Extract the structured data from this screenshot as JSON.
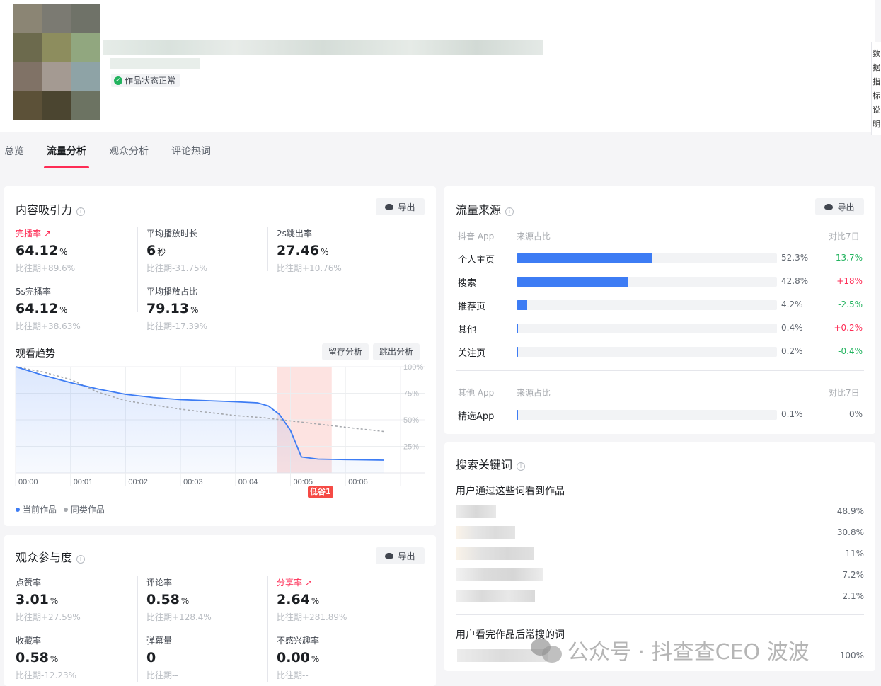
{
  "header": {
    "status_text": "作品状态正常",
    "side_text": [
      "数",
      "据",
      "指",
      "标",
      "说",
      "明"
    ]
  },
  "tabs": [
    {
      "label": "总览",
      "active": false
    },
    {
      "label": "流量分析",
      "active": true
    },
    {
      "label": "观众分析",
      "active": false
    },
    {
      "label": "评论热词",
      "active": false
    }
  ],
  "content_appeal": {
    "title": "内容吸引力",
    "export_label": "导出",
    "metrics": [
      {
        "label": "完播率",
        "value": "64.12",
        "unit": "%",
        "compare": "比往期+89.6%",
        "highlight": true
      },
      {
        "label": "平均播放时长",
        "value": "6",
        "unit": "秒",
        "compare": "比往期-31.75%",
        "highlight": false
      },
      {
        "label": "2s跳出率",
        "value": "27.46",
        "unit": "%",
        "compare": "比往期+10.76%",
        "highlight": false
      },
      {
        "label": "5s完播率",
        "value": "64.12",
        "unit": "%",
        "compare": "比往期+38.63%",
        "highlight": false
      },
      {
        "label": "平均播放占比",
        "value": "79.13",
        "unit": "%",
        "compare": "比往期-17.39%",
        "highlight": false
      }
    ],
    "trend_title": "观看趋势",
    "retention_btn": "留存分析",
    "bounce_btn": "跳出分析",
    "low_valley_label": "低谷1",
    "legend": [
      {
        "name": "当前作品",
        "color": "#3d7cf4"
      },
      {
        "name": "同类作品",
        "color": "#a6a9ae"
      }
    ]
  },
  "chart_data": {
    "type": "line",
    "x": [
      "00:00",
      "00:01",
      "00:02",
      "00:03",
      "00:04",
      "00:05",
      "00:06"
    ],
    "ylim": [
      0,
      100
    ],
    "yticks": [
      "100%",
      "75%",
      "50%",
      "25%"
    ],
    "grid": true,
    "legend_position": "bottom-left",
    "series": [
      {
        "name": "当前作品",
        "color": "#3d7cf4",
        "x": [
          0,
          0.5,
          1,
          1.5,
          2,
          2.5,
          3,
          3.5,
          4,
          4.4,
          4.6,
          4.8,
          5.0,
          5.2,
          5.5,
          6.0,
          6.7
        ],
        "values": [
          100,
          92,
          85,
          79,
          74,
          71,
          69,
          68,
          67,
          66,
          63,
          55,
          40,
          15,
          13,
          12.5,
          12
        ]
      },
      {
        "name": "同类作品",
        "color": "#a6a9ae",
        "x": [
          0,
          0.5,
          1,
          1.5,
          2,
          2.5,
          3,
          3.5,
          4,
          4.5,
          5,
          5.5,
          6,
          6.7
        ],
        "values": [
          100,
          95,
          88,
          76,
          68,
          64,
          60,
          57,
          54,
          52,
          49,
          46,
          43,
          39
        ]
      }
    ],
    "highlight_band": {
      "x_start": 4.75,
      "x_end": 5.75,
      "label": "低谷1"
    }
  },
  "traffic_source": {
    "title": "流量来源",
    "export_label": "导出",
    "douyin_header": [
      "抖音 App",
      "来源占比",
      "对比7日"
    ],
    "douyin_rows": [
      {
        "name": "个人主页",
        "pct": "52.3%",
        "ratio": 52.3,
        "change": "-13.7%",
        "dir": "down"
      },
      {
        "name": "搜索",
        "pct": "42.8%",
        "ratio": 42.8,
        "change": "+18%",
        "dir": "up"
      },
      {
        "name": "推荐页",
        "pct": "4.2%",
        "ratio": 4.2,
        "change": "-2.5%",
        "dir": "down"
      },
      {
        "name": "其他",
        "pct": "0.4%",
        "ratio": 0.4,
        "change": "+0.2%",
        "dir": "up"
      },
      {
        "name": "关注页",
        "pct": "0.2%",
        "ratio": 0.2,
        "change": "-0.4%",
        "dir": "down"
      }
    ],
    "other_header": [
      "其他 App",
      "来源占比",
      "对比7日"
    ],
    "other_rows": [
      {
        "name": "精选App",
        "pct": "0.1%",
        "ratio": 0.1,
        "change": "0%",
        "dir": "flat"
      }
    ]
  },
  "search_keywords": {
    "title": "搜索关键词",
    "sub1": "用户通过这些词看到作品",
    "pcts": [
      "48.9%",
      "30.8%",
      "11%",
      "7.2%",
      "2.1%"
    ],
    "sub2": "用户看完作品后常搜的词",
    "pct2": "100%"
  },
  "engagement": {
    "title": "观众参与度",
    "export_label": "导出",
    "metrics": [
      {
        "label": "点赞率",
        "value": "3.01",
        "unit": "%",
        "compare": "比往期+27.59%",
        "highlight": false
      },
      {
        "label": "评论率",
        "value": "0.58",
        "unit": "%",
        "compare": "比往期+128.4%",
        "highlight": false
      },
      {
        "label": "分享率",
        "value": "2.64",
        "unit": "%",
        "compare": "比往期+281.89%",
        "highlight": true
      },
      {
        "label": "收藏率",
        "value": "0.58",
        "unit": "%",
        "compare": "比往期-12.23%",
        "highlight": false
      },
      {
        "label": "弹幕量",
        "value": "0",
        "unit": "",
        "compare": "比往期--",
        "highlight": false
      },
      {
        "label": "不感兴趣率",
        "value": "0.00",
        "unit": "%",
        "compare": "比往期--",
        "highlight": false
      }
    ]
  },
  "watermark": "公众号 · 抖查查CEO 波波"
}
